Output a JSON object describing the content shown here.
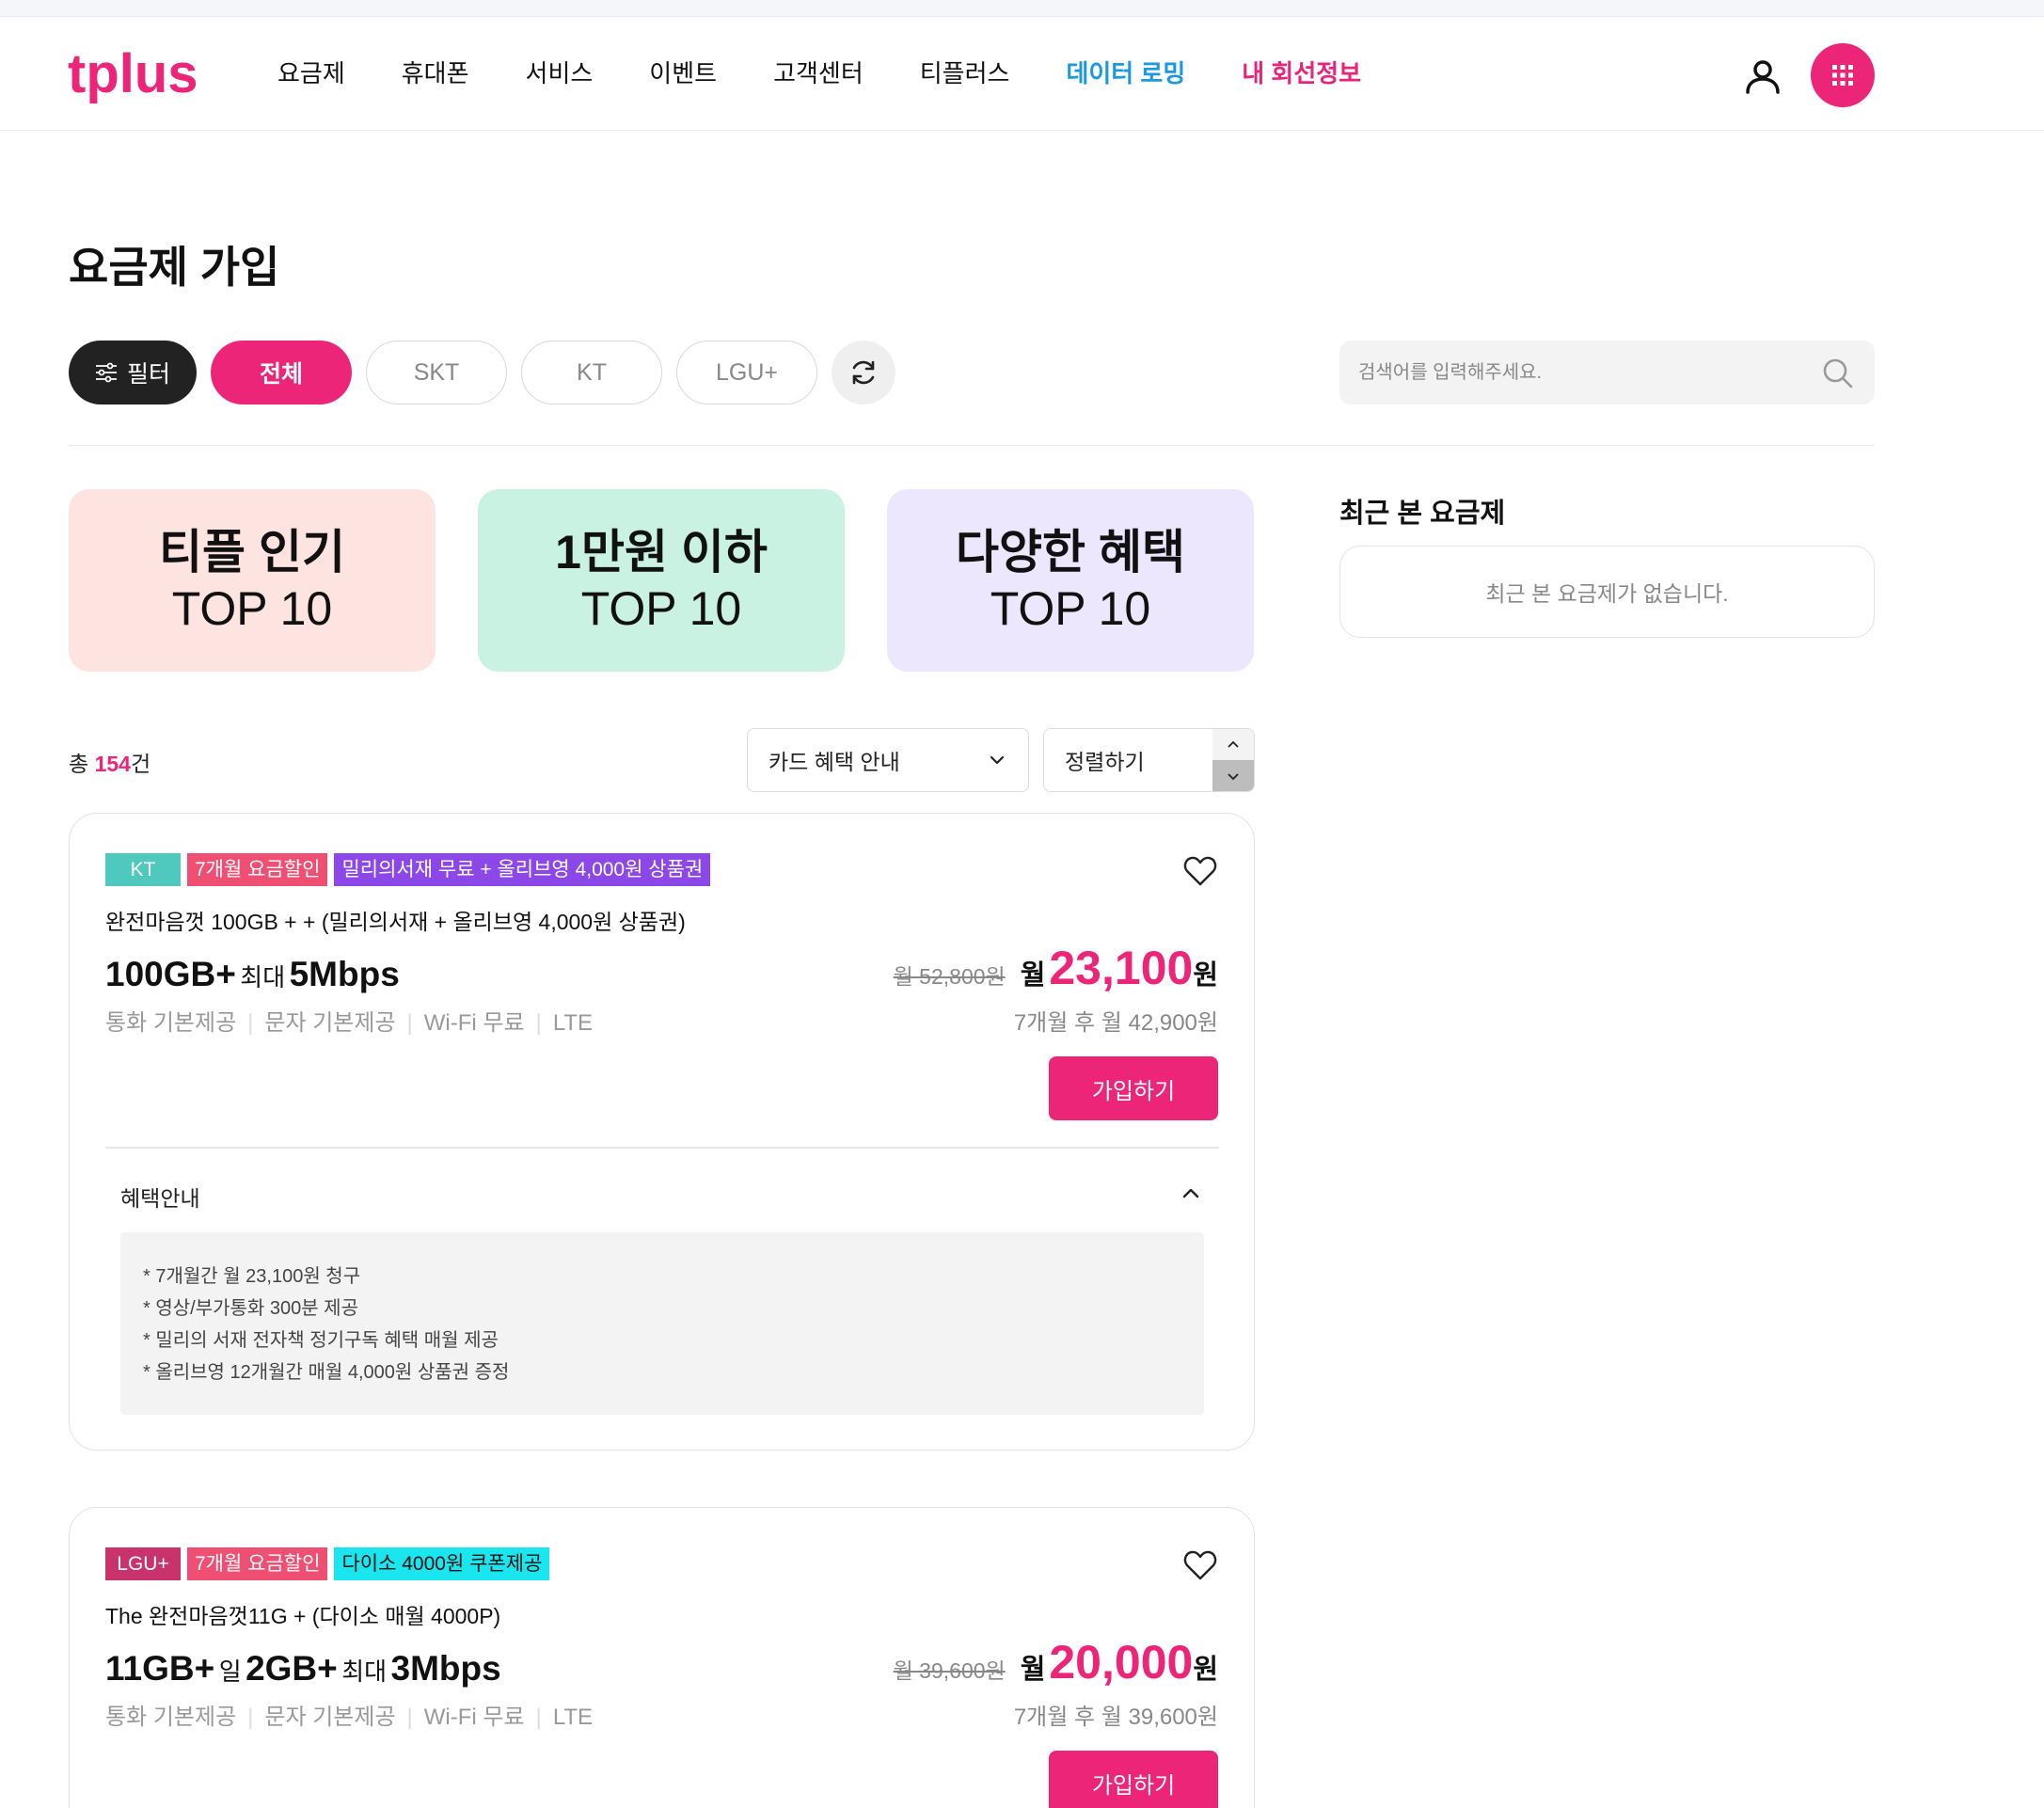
{
  "header": {
    "logo_text": "tplus",
    "nav": [
      "요금제",
      "휴대폰",
      "서비스",
      "이벤트",
      "고객센터",
      "티플러스",
      "데이터 로밍",
      "내 회선정보"
    ],
    "user_icon": "user-icon",
    "apps_icon": "grid-icon"
  },
  "page": {
    "title": "요금제 가입"
  },
  "filters": {
    "filter_label": "필터",
    "chips": [
      "전체",
      "SKT",
      "KT",
      "LGU+"
    ],
    "selected": "전체",
    "refresh_icon": "refresh-icon"
  },
  "search": {
    "placeholder": "검색어를 입력해주세요.",
    "value": ""
  },
  "top_cards": [
    {
      "line1": "티플 인기",
      "line2": "TOP 10",
      "color": "#fde4e0"
    },
    {
      "line1": "1만원 이하",
      "line2": "TOP 10",
      "color": "#c9f2e3"
    },
    {
      "line1": "다양한 혜택",
      "line2": "TOP 10",
      "color": "#ece7fd"
    }
  ],
  "recent": {
    "title": "최근 본 요금제",
    "empty_text": "최근 본 요금제가 없습니다."
  },
  "list": {
    "total_prefix": "총 ",
    "total_count": "154",
    "total_suffix": "건",
    "card_benefit_label": "카드 혜택 안내",
    "sort_label": "정렬하기"
  },
  "plans": [
    {
      "carrier": "KT",
      "tags": [
        "7개월 요금할인",
        "밀리의서재 무료 + 올리브영 4,000원 상품권"
      ],
      "name": "완전마음껏 100GB + + (밀리의서재 + 올리브영 4,000원 상품권)",
      "data_main": "100GB+",
      "data_mid": "",
      "data_mid_val": "",
      "speed_label": "최대",
      "speed": "5Mbps",
      "features": [
        "통화 기본제공",
        "문자 기본제공",
        "Wi-Fi 무료",
        "LTE"
      ],
      "orig_price": "월 52,800원",
      "month_label": "월",
      "sale_price": "23,100",
      "won": "원",
      "after_price": "7개월 후 월 42,900원",
      "join_label": "가입하기",
      "benefit_title": "혜택안내",
      "benefits": [
        "* 7개월간 월 23,100원 청구",
        "* 영상/부가통화 300분 제공",
        "* 밀리의 서재 전자책 정기구독 혜택 매월 제공",
        "* 올리브영 12개월간 매월 4,000원 상품권 증정"
      ]
    },
    {
      "carrier": "LGU+",
      "tags": [
        "7개월 요금할인",
        "다이소 4000원 쿠폰제공"
      ],
      "name": "The 완전마음껏11G + (다이소 매월 4000P)",
      "data_main": "11GB+",
      "data_mid": "일",
      "data_mid_val": "2GB+",
      "speed_label": "최대",
      "speed": "3Mbps",
      "features": [
        "통화 기본제공",
        "문자 기본제공",
        "Wi-Fi 무료",
        "LTE"
      ],
      "orig_price": "월 39,600원",
      "month_label": "월",
      "sale_price": "20,000",
      "won": "원",
      "after_price": "7개월 후 월 39,600원",
      "join_label": "가입하기"
    }
  ],
  "colors": {
    "brand_pink": "#ec2579",
    "roaming_blue": "#1a98e0",
    "kt_tag": "#4fc9bd",
    "lgu_tag": "#c8336b"
  }
}
